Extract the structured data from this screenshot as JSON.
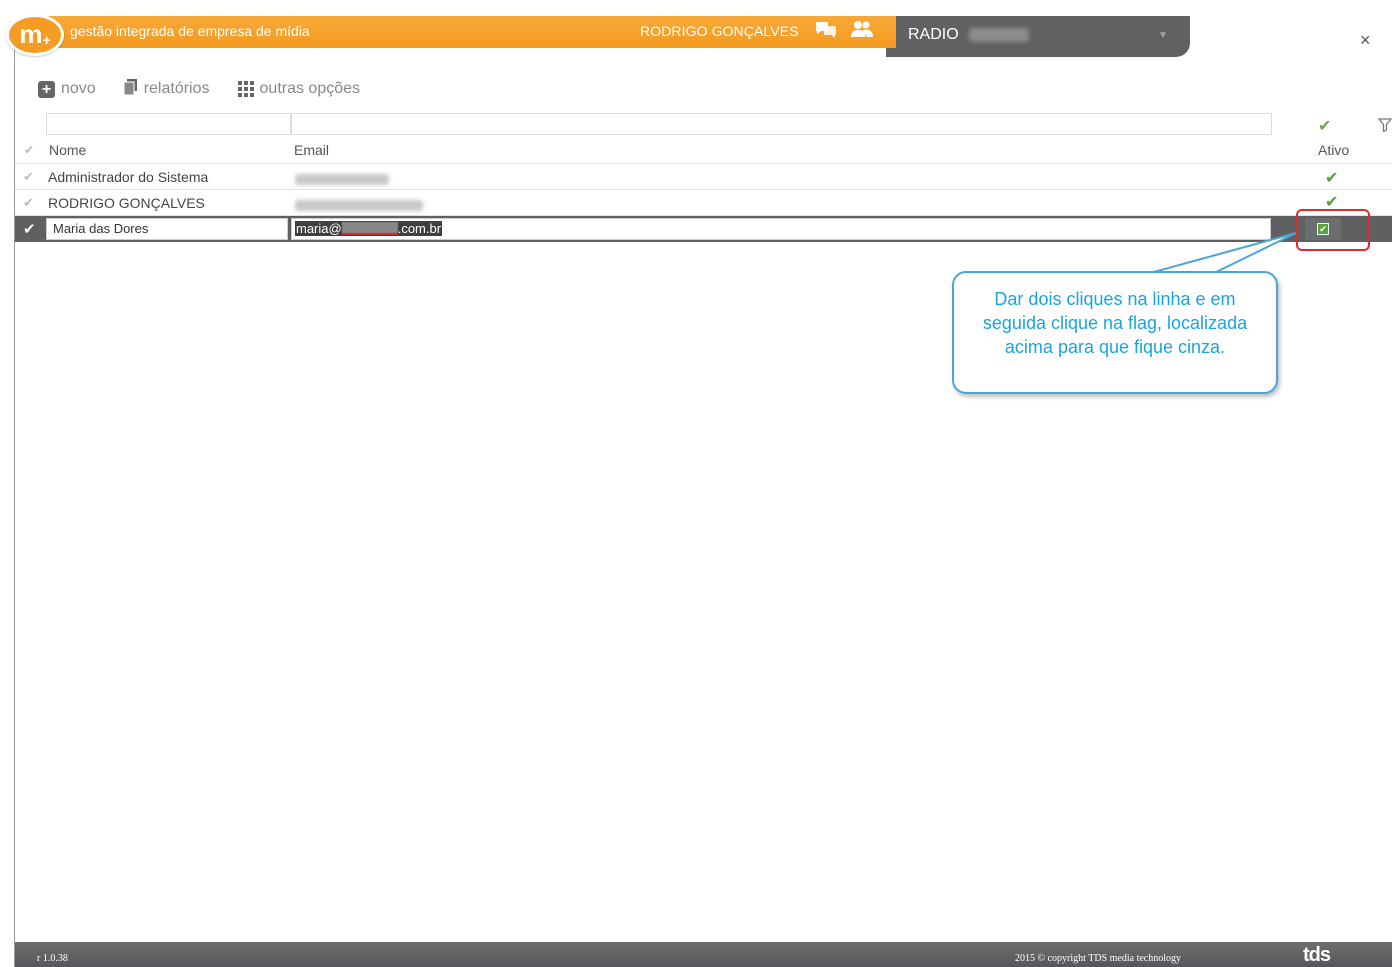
{
  "header": {
    "logo_text": "m",
    "logo_sub": "+",
    "tagline": "gestão integrada de empresa de mídia",
    "user_name": "RODRIGO GONÇALVES",
    "company_label": "RADIO",
    "close_symbol": "×",
    "icons": [
      "chat-icon",
      "users-icon",
      "chevron-down-icon",
      "close-icon"
    ]
  },
  "toolbar": {
    "new_label": "novo",
    "reports_label": "relatórios",
    "more_label": "outras opções"
  },
  "table": {
    "columns": {
      "name": "Nome",
      "email": "Email",
      "active": "Ativo"
    },
    "rows": [
      {
        "name": "Administrador do Sistema",
        "email": "",
        "active": true
      },
      {
        "name": "RODRIGO GONÇALVES",
        "email": "",
        "active": true
      },
      {
        "name": "Maria das Dores",
        "email_prefix": "maria@",
        "email_suffix": ".com.br",
        "active": true,
        "selected": true
      }
    ]
  },
  "callout": {
    "text": "Dar dois cliques na linha e em seguida clique na flag, localizada acima para que fique cinza."
  },
  "footer": {
    "version": "r 1.0.38",
    "copyright": "2015 © copyright TDS media technology",
    "brand": "tds"
  },
  "colors": {
    "accent_orange": "#f39a1e",
    "header_gray": "#5f6163",
    "check_green": "#5a9e3a",
    "callout_blue": "#1ba3e0",
    "highlight_red": "#e02b2b"
  }
}
